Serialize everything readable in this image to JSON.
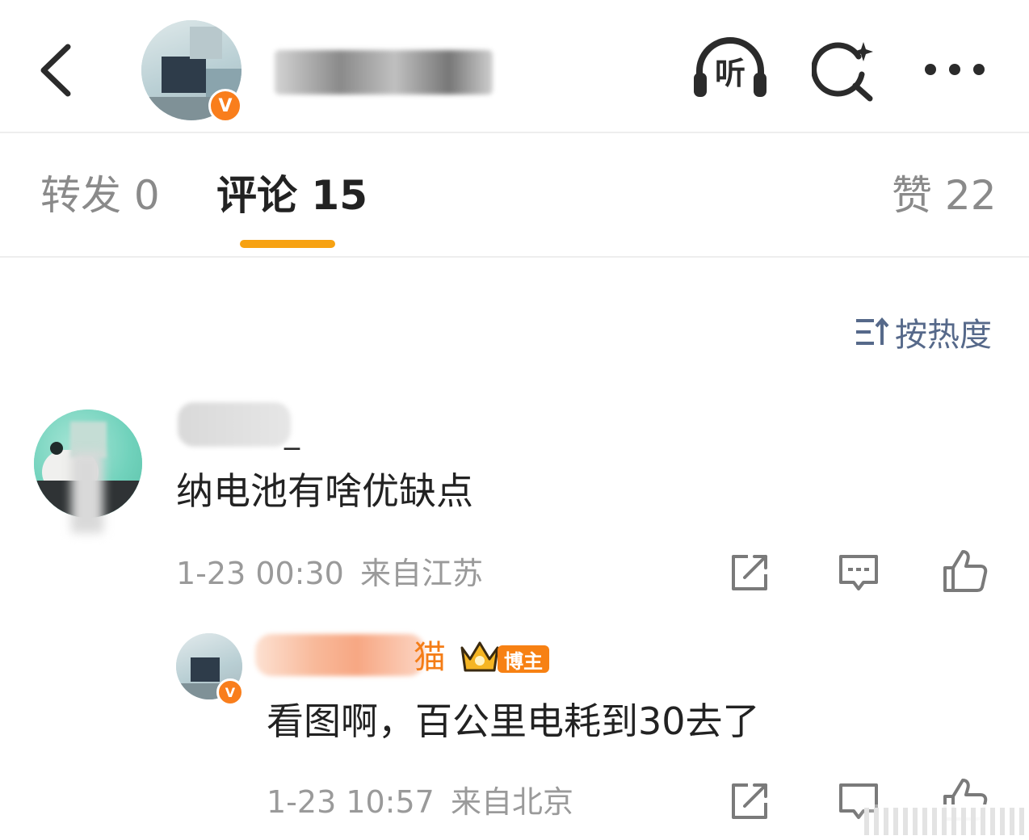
{
  "header": {
    "back_icon": "chevron-left-icon",
    "listen_label": "听",
    "search_icon": "search-sparkle-icon",
    "more_icon": "more-dots-icon"
  },
  "tabs": [
    {
      "label": "转发 0"
    },
    {
      "label": "评论 15"
    },
    {
      "label": "赞 22"
    }
  ],
  "sort": {
    "icon": "sort-icon",
    "label": "按热度"
  },
  "comments": [
    {
      "user_suffix": "_",
      "text": "纳电池有啥优缺点",
      "time": "1-23 00:30",
      "location": "来自江苏"
    }
  ],
  "replies": [
    {
      "user_suffix": "猫",
      "badge": "博主",
      "text": "看图啊，百公里电耗到30去了",
      "time": "1-23 10:57",
      "location": "来自北京"
    }
  ],
  "colors": {
    "accent": "#f7a212",
    "verified_badge": "#f97e1c",
    "sort_text": "#56698a",
    "meta_text": "#9a9a9a"
  }
}
